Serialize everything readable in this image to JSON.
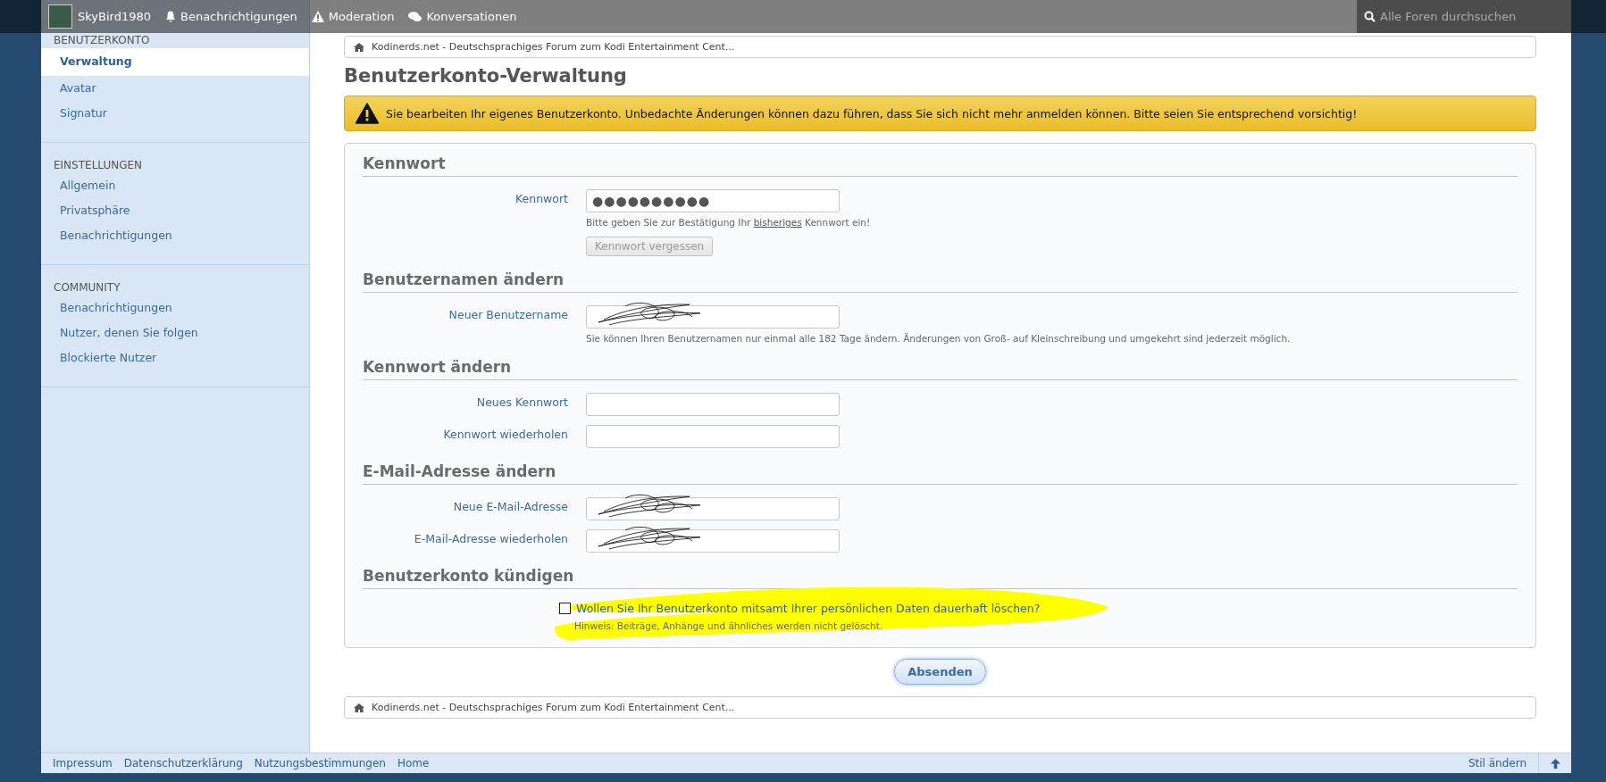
{
  "top_bar": {
    "user": "SkyBird1980",
    "links": [
      {
        "label": "Benachrichtigungen"
      },
      {
        "label": "Moderation"
      },
      {
        "label": "Konversationen"
      }
    ],
    "search": {
      "placeholder": "Alle Foren durchsuchen"
    }
  },
  "sidebar": {
    "sections": [
      {
        "title": "BENUTZERKONTO",
        "items": [
          {
            "label": "Verwaltung",
            "selected": true
          },
          {
            "label": "Avatar",
            "selected": false
          },
          {
            "label": "Signatur",
            "selected": false
          }
        ]
      },
      {
        "title": "EINSTELLUNGEN",
        "items": [
          {
            "label": "Allgemein",
            "selected": false
          },
          {
            "label": "Privatsphäre",
            "selected": false
          },
          {
            "label": "Benachrichtigungen",
            "selected": false
          }
        ]
      },
      {
        "title": "COMMUNITY",
        "items": [
          {
            "label": "Benachrichtigungen",
            "selected": false
          },
          {
            "label": "Nutzer, denen Sie folgen",
            "selected": false
          },
          {
            "label": "Blockierte Nutzer",
            "selected": false
          }
        ]
      }
    ]
  },
  "breadcrumb_top": {
    "label": "Kodinerds.net - Deutschsprachiges Forum zum Kodi Entertainment Cent..."
  },
  "page_title": "Benutzerkonto-Verwaltung",
  "warning": "Sie bearbeiten Ihr eigenes Benutzerkonto. Unbedachte Änderungen können dazu führen, dass Sie sich nicht mehr anmelden können. Bitte seien Sie entsprechend vorsichtig!",
  "form": {
    "sections": [
      {
        "title": "Kennwort",
        "rows": [
          {
            "kind": "field",
            "label": "Kennwort",
            "value": "●●●●●●●●●●",
            "hint": {
              "before": "Bitte geben Sie zur Bestätigung Ihr ",
              "link": "bisheriges",
              "after": " Kennwort ein!"
            }
          },
          {
            "kind": "button",
            "label": "Kennwort vergessen",
            "disabled": true
          }
        ]
      },
      {
        "title": "Benutzernamen ändern",
        "rows": [
          {
            "kind": "field",
            "label": "Neuer Benutzername",
            "redacted": true,
            "hint": {
              "before": "Sie können Ihren Benutzernamen nur einmal alle 182 Tage ändern. Änderungen von Groß- auf Kleinschreibung und umgekehrt sind jederzeit möglich."
            }
          }
        ]
      },
      {
        "title": "Kennwort ändern",
        "rows": [
          {
            "kind": "field",
            "label": "Neues Kennwort"
          },
          {
            "kind": "field",
            "label": "Kennwort wiederholen"
          }
        ]
      },
      {
        "title": "E-Mail-Adresse ändern",
        "rows": [
          {
            "kind": "field",
            "label": "Neue E-Mail-Adresse",
            "redacted": true
          },
          {
            "kind": "field",
            "label": "E-Mail-Adresse wiederholen",
            "redacted": true
          }
        ]
      },
      {
        "title": "Benutzerkonto kündigen",
        "rows": [
          {
            "kind": "checkbox",
            "label": "Wollen Sie Ihr Benutzerkonto mitsamt Ihrer persönlichen Daten dauerhaft löschen?",
            "checked": false,
            "highlighted": true,
            "hint": {
              "before": "Hinweis: Beiträge, Anhänge und ähnliches werden nicht gelöscht."
            }
          }
        ]
      }
    ]
  },
  "submit": "Absenden",
  "breadcrumb_bottom": {
    "label": "Kodinerds.net - Deutschsprachiges Forum zum Kodi Entertainment Cent..."
  },
  "footer": {
    "links": [
      "Impressum",
      "Datenschutzerklärung",
      "Nutzungsbestimmungen",
      "Home"
    ],
    "style_link": "Stil ändern"
  }
}
